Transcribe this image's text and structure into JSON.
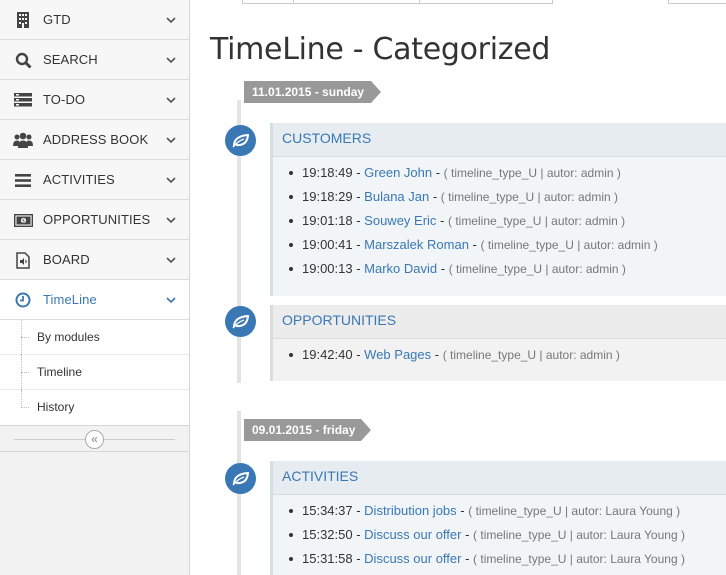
{
  "sidebar": {
    "items": [
      {
        "label": "GTD",
        "icon": "building-icon"
      },
      {
        "label": "SEARCH",
        "icon": "search-icon"
      },
      {
        "label": "TO-DO",
        "icon": "server-list-icon"
      },
      {
        "label": "ADDRESS BOOK",
        "icon": "users-icon"
      },
      {
        "label": "ACTIVITIES",
        "icon": "bars-icon"
      },
      {
        "label": "OPPORTUNITIES",
        "icon": "money-icon"
      },
      {
        "label": "BOARD",
        "icon": "audio-file-icon"
      },
      {
        "label": "TimeLine",
        "icon": "clock-icon"
      }
    ],
    "submenu": [
      "By modules",
      "Timeline",
      "History"
    ],
    "collapse_icon": "double-chevron-left-icon"
  },
  "main": {
    "title": "TimeLine - Categorized",
    "days": [
      {
        "date": "11.01.2015 - sunday",
        "groups": [
          {
            "title": "CUSTOMERS",
            "icon": "leaf-icon",
            "entries": [
              {
                "time": "19:18:49",
                "name": "Green John",
                "meta": "( timeline_type_U | autor: admin )"
              },
              {
                "time": "19:18:29",
                "name": "Bulana Jan",
                "meta": "( timeline_type_U | autor: admin )"
              },
              {
                "time": "19:01:18",
                "name": "Souwey Eric",
                "meta": "( timeline_type_U | autor: admin )"
              },
              {
                "time": "19:00:41",
                "name": "Marszalek Roman",
                "meta": "( timeline_type_U | autor: admin )"
              },
              {
                "time": "19:00:13",
                "name": "Marko David",
                "meta": "( timeline_type_U | autor: admin )"
              }
            ]
          },
          {
            "title": "OPPORTUNITIES",
            "icon": "leaf-icon",
            "entries": [
              {
                "time": "19:42:40",
                "name": "Web Pages",
                "meta": "( timeline_type_U | autor: admin )"
              }
            ]
          }
        ]
      },
      {
        "date": "09.01.2015 - friday",
        "groups": [
          {
            "title": "ACTIVITIES",
            "icon": "leaf-icon",
            "entries": [
              {
                "time": "15:34:37",
                "name": "Distribution jobs",
                "meta": "( timeline_type_U | autor: Laura Young )"
              },
              {
                "time": "15:32:50",
                "name": "Discuss our offer",
                "meta": "( timeline_type_U | autor: Laura Young )"
              },
              {
                "time": "15:31:58",
                "name": "Discuss our offer",
                "meta": "( timeline_type_U | autor: Laura Young )"
              }
            ]
          }
        ]
      }
    ]
  },
  "colors": {
    "accent": "#3a78b5",
    "date_tag": "#999999"
  }
}
